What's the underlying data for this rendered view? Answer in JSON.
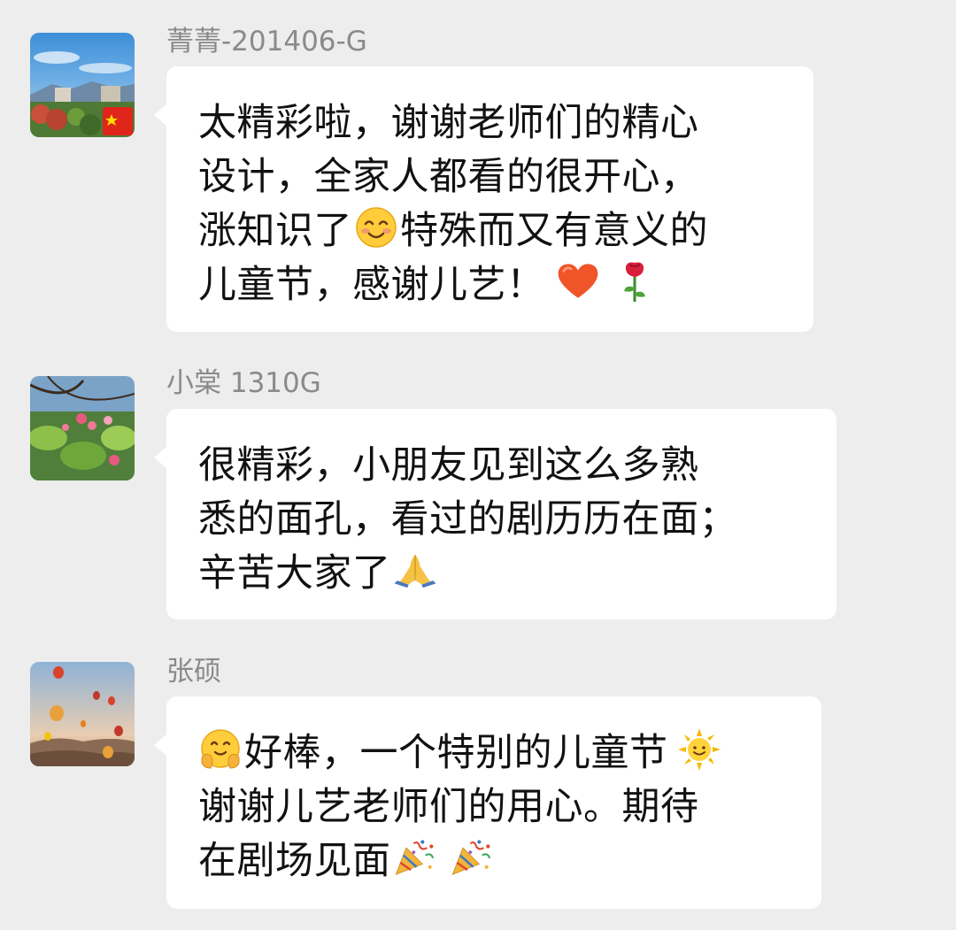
{
  "messages": [
    {
      "sender": "菁菁-201406-G",
      "avatar_icon": "campus-landscape-avatar",
      "lines": [
        {
          "a": "太精彩啦，谢谢老师们的精心"
        },
        {
          "a": "设计，全家人都看的很开心，"
        },
        {
          "a": "涨知识了",
          "b": "特殊而又有意义的"
        },
        {
          "a": "儿童节，感谢儿艺！"
        }
      ],
      "emojis": [
        "smiling-face-icon",
        "heart-icon",
        "rose-icon"
      ]
    },
    {
      "sender": "小棠 1310G",
      "avatar_icon": "flower-tree-avatar",
      "lines": [
        {
          "a": "很精彩，小朋友见到这么多熟"
        },
        {
          "a": "悉的面孔，看过的剧历历在面；"
        },
        {
          "a": "辛苦大家了"
        }
      ],
      "emojis": [
        "folded-hands-icon"
      ]
    },
    {
      "sender": "张硕",
      "avatar_icon": "hot-air-balloons-avatar",
      "lines": [
        {
          "a": "好棒，一个特别的儿童节"
        },
        {
          "a": "谢谢儿艺老师们的用心。期待"
        },
        {
          "a": "在剧场见面"
        }
      ],
      "emojis": [
        "hugging-face-icon",
        "sun-face-icon",
        "party-popper-icon",
        "party-popper-icon"
      ]
    }
  ],
  "colors": {
    "background": "#ededed",
    "bubble": "#ffffff",
    "sender_name": "#8a8a8a",
    "message_text": "#111111"
  }
}
